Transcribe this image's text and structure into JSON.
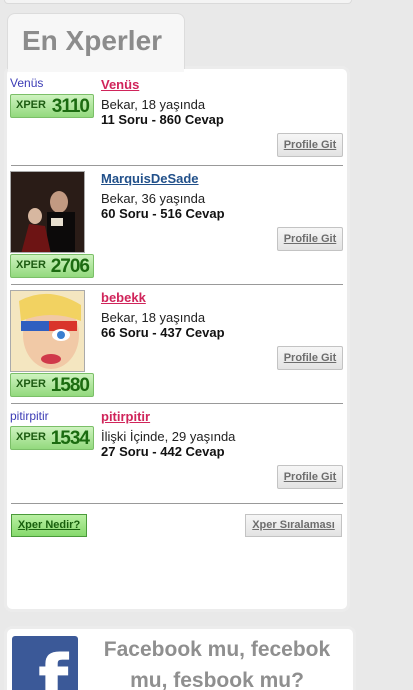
{
  "section_title": "En Xperler",
  "xper_label": "XPER",
  "profile_button": "Profile Git",
  "users": [
    {
      "avatar_alt": "Venüs",
      "score": "3110",
      "name": "Venüs",
      "status": "Bekar, 18 yaşında",
      "stats": "11 Soru - 860 Cevap"
    },
    {
      "avatar_alt": "",
      "score": "2706",
      "name": "MarquisDeSade",
      "status": "Bekar, 36 yaşında",
      "stats": "60 Soru - 516 Cevap"
    },
    {
      "avatar_alt": "",
      "score": "1580",
      "name": "bebekk",
      "status": "Bekar, 18 yaşında",
      "stats": "66 Soru - 437 Cevap"
    },
    {
      "avatar_alt": "pitirpitir",
      "score": "1534",
      "name": "pitirpitir",
      "status": "İlişki İçinde, 29 yaşında",
      "stats": "27 Soru - 442 Cevap"
    }
  ],
  "footer": {
    "what_is_xper": "Xper Nedir?",
    "ranking": "Xper Sıralaması"
  },
  "facebook_promo": {
    "logo_letter": "f",
    "title": "Facebook mu, fecebok mu, fesbook mu?"
  },
  "colors": {
    "female_name": "#d0245a",
    "male_name": "#21508a",
    "xper_green": "#93d97d"
  }
}
